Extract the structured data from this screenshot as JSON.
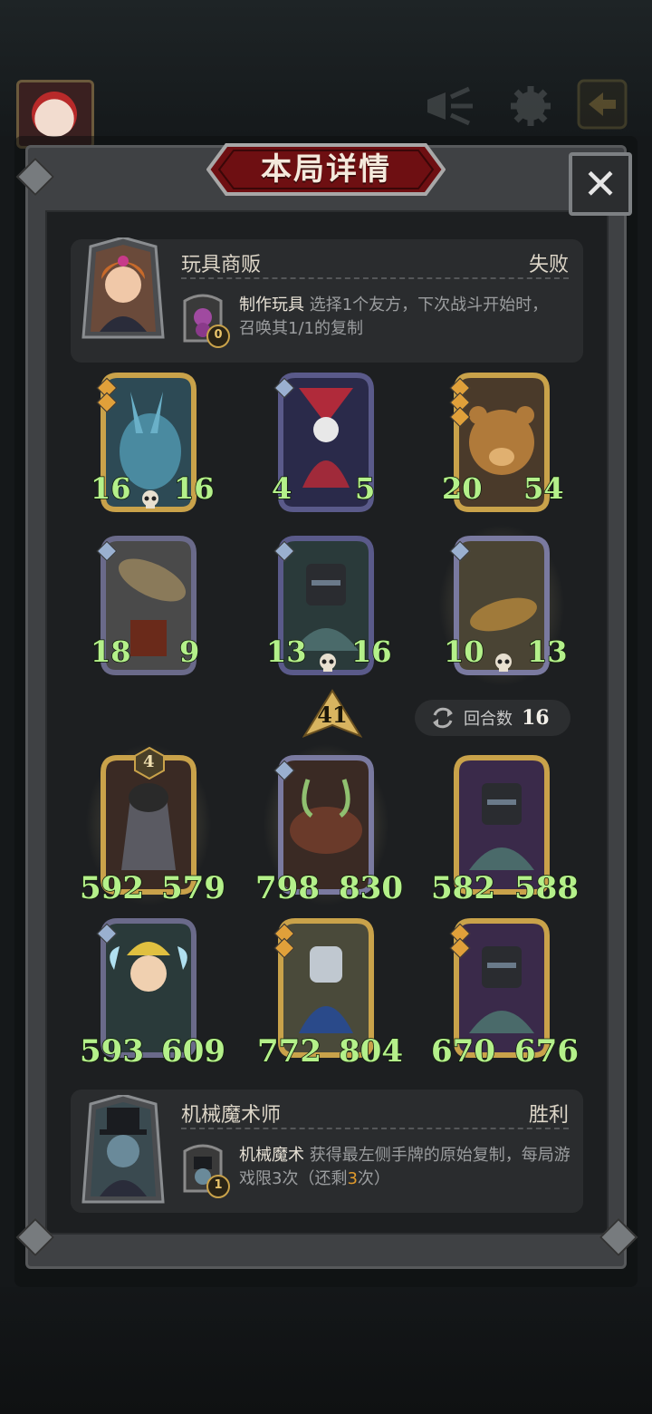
{
  "title": "本局详情",
  "opponent": {
    "name": "玩具商贩",
    "result": "失败",
    "skill_name": "制作玩具",
    "skill_desc": "选择1个友方，下次战斗开始时，召唤其1/1的复制",
    "skill_count": "0"
  },
  "opponent_board": [
    {
      "attack": "16",
      "health": "16"
    },
    {
      "attack": "4",
      "health": "5"
    },
    {
      "attack": "20",
      "health": "54"
    },
    {
      "attack": "18",
      "health": "9"
    },
    {
      "attack": "13",
      "health": "16"
    },
    {
      "attack": "10",
      "health": "13"
    }
  ],
  "score": "41",
  "rounds": {
    "label": "回合数",
    "value": "16"
  },
  "tier": "4",
  "player_board": [
    {
      "attack": "592",
      "health": "579"
    },
    {
      "attack": "798",
      "health": "830"
    },
    {
      "attack": "582",
      "health": "588"
    },
    {
      "attack": "593",
      "health": "609"
    },
    {
      "attack": "772",
      "health": "804"
    },
    {
      "attack": "670",
      "health": "676"
    }
  ],
  "player": {
    "name": "机械魔术师",
    "result": "胜利",
    "skill_name": "机械魔术",
    "skill_desc_a": "获得最左侧手牌的原始复制，每局游戏限3次（还剩",
    "skill_desc_hl": "3",
    "skill_desc_b": "次）",
    "skill_count": "1"
  },
  "colors": {
    "stat_green": "#b4f08a",
    "gold_frame": "#c9a24a",
    "purple_frame": "#5a4a8a",
    "highlight_orange": "#e09a2c"
  }
}
